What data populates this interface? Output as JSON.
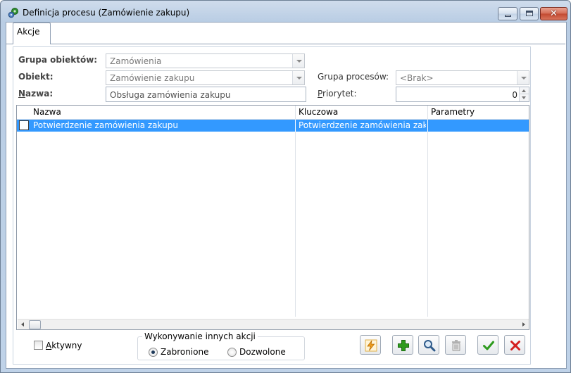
{
  "window": {
    "title": "Definicja procesu (Zamówienie zakupu)",
    "close_glyph": "✕"
  },
  "tabs": [
    {
      "label": "Akcje",
      "active": true
    }
  ],
  "form": {
    "grupa_obiektow": {
      "label": "Grupa obiektów:",
      "value": "Zamówienia"
    },
    "obiekt": {
      "label": "Obiekt:",
      "value": "Zamówienie zakupu"
    },
    "nazwa": {
      "label_underlined": "N",
      "label_rest": "azwa:",
      "value": "Obsługa zamówienia zakupu"
    },
    "grupa_procesow": {
      "label": "Grupa procesów:",
      "value": "<Brak>"
    },
    "priorytet": {
      "label_underlined": "P",
      "label_rest": "riorytet:",
      "value": "0"
    }
  },
  "grid": {
    "columns": [
      "Nazwa",
      "Kluczowa",
      "Parametry"
    ],
    "rows": [
      {
        "checked": false,
        "nazwa": "Potwierdzenie zamówienia zakupu",
        "kluczowa": "Potwierdzenie zamówienia zakupu",
        "parametry": "",
        "selected": true
      }
    ]
  },
  "footer": {
    "aktywny": {
      "label_underlined": "A",
      "label_rest": "ktywny",
      "checked": false
    },
    "group_legend": "Wykonywanie innych akcji",
    "radio_options": [
      {
        "label": "Zabronione",
        "selected": true
      },
      {
        "label": "Dozwolone",
        "selected": false
      }
    ]
  },
  "toolbar": {
    "icons": [
      "lightning-icon",
      "plus-icon",
      "magnifier-icon",
      "trash-icon",
      "check-icon",
      "close-icon"
    ]
  },
  "colors": {
    "selection": "#3399ff",
    "accent_green": "#2e9b1e",
    "accent_red": "#d42020",
    "lightning": "#f0a020"
  }
}
